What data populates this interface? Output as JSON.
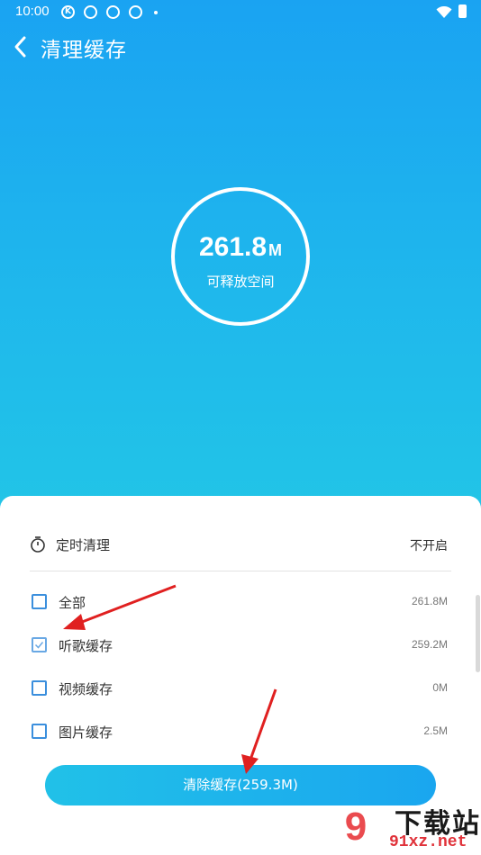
{
  "status_bar": {
    "time": "10:00",
    "icons": [
      "k-icon",
      "app-icon",
      "app-icon",
      "app-icon",
      "dot",
      "wifi-icon",
      "battery-icon"
    ]
  },
  "header": {
    "title": "清理缓存",
    "back_icon": "chevron-left-icon"
  },
  "summary": {
    "size_value": "261.8",
    "size_unit": "M",
    "label": "可释放空间"
  },
  "sheet": {
    "timer": {
      "icon": "stopwatch-icon",
      "label": "定时清理",
      "value": "不开启"
    },
    "items": [
      {
        "label": "全部",
        "size": "261.8M",
        "checked": false
      },
      {
        "label": "听歌缓存",
        "size": "259.2M",
        "checked": true
      },
      {
        "label": "视频缓存",
        "size": "0M",
        "checked": false
      },
      {
        "label": "图片缓存",
        "size": "2.5M",
        "checked": false
      }
    ],
    "clean_button_label": "清除缓存(259.3M)"
  },
  "watermark": {
    "logo_text": "9",
    "title": "下载站",
    "url": "91xz.net"
  },
  "colors": {
    "hero_top": "#1aa3f2",
    "hero_bottom": "#22c6e6",
    "checkbox": "#3b8fdd",
    "annotation_arrow": "#e02020"
  }
}
